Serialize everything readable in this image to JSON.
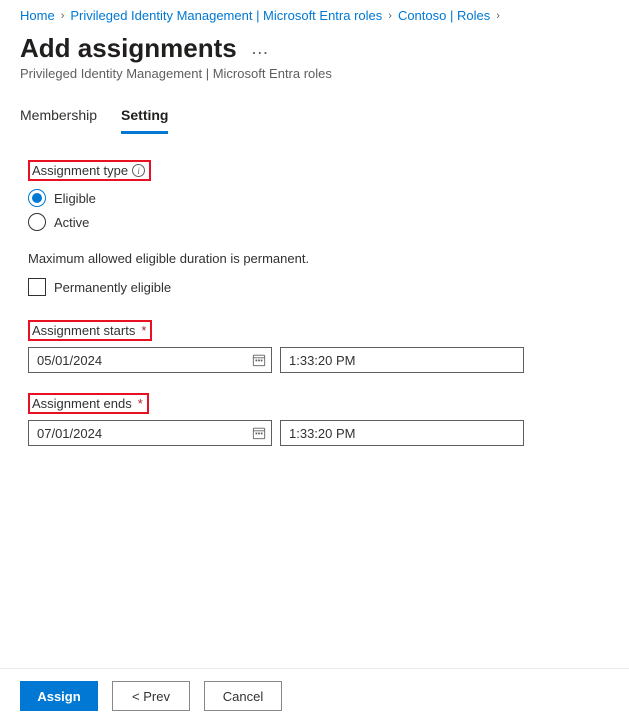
{
  "breadcrumb": {
    "items": [
      "Home",
      "Privileged Identity Management | Microsoft Entra roles",
      "Contoso | Roles"
    ],
    "chevron": "›"
  },
  "header": {
    "title": "Add assignments",
    "ellipsis": "…",
    "subtitle": "Privileged Identity Management | Microsoft Entra roles"
  },
  "tabs": {
    "membership": "Membership",
    "setting": "Setting",
    "active": "setting"
  },
  "form": {
    "assignment_type_label": "Assignment type",
    "eligible_label": "Eligible",
    "active_label": "Active",
    "selected_type": "eligible",
    "max_duration_text": "Maximum allowed eligible duration is permanent.",
    "perm_eligible_label": "Permanently eligible",
    "perm_eligible_checked": false,
    "starts_label": "Assignment starts",
    "starts_date": "05/01/2024",
    "starts_time": "1:33:20 PM",
    "ends_label": "Assignment ends",
    "ends_date": "07/01/2024",
    "ends_time": "1:33:20 PM",
    "required_mark": "*"
  },
  "footer": {
    "assign": "Assign",
    "prev": "<  Prev",
    "cancel": "Cancel"
  }
}
